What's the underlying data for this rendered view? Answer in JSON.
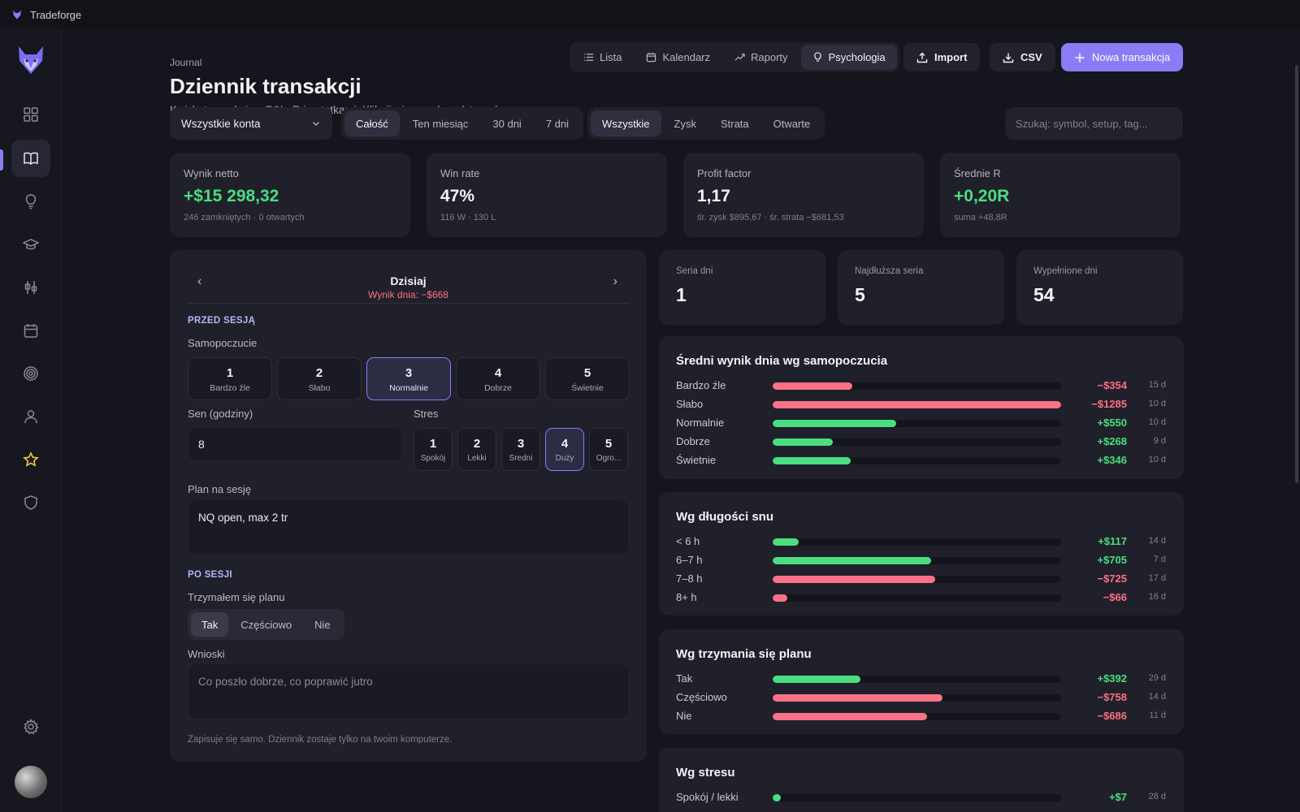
{
  "app": {
    "title": "Tradeforge"
  },
  "sidebar": {
    "items": [
      {
        "name": "dashboard",
        "icon": "grid-icon"
      },
      {
        "name": "journal",
        "icon": "book-icon",
        "active": true
      },
      {
        "name": "ideas",
        "icon": "lightbulb-icon"
      },
      {
        "name": "learn",
        "icon": "graduation-cap-icon"
      },
      {
        "name": "strategy",
        "icon": "sliders-icon"
      },
      {
        "name": "calendar",
        "icon": "calendar-icon"
      },
      {
        "name": "goals",
        "icon": "target-icon"
      },
      {
        "name": "profile",
        "icon": "user-icon"
      },
      {
        "name": "favorites",
        "icon": "star-icon"
      },
      {
        "name": "security",
        "icon": "shield-icon"
      }
    ],
    "accent": "#8b7cf6"
  },
  "header": {
    "breadcrumb": "Journal",
    "title": "Dziennik transakcji",
    "subtitle": "Każda transakcja z P&L, R i notatkami. Kliknij wiersz, aby edytować.",
    "view_tabs": [
      {
        "label": "Lista",
        "icon": "list-icon"
      },
      {
        "label": "Kalendarz",
        "icon": "calendar-icon"
      },
      {
        "label": "Raporty",
        "icon": "trend-icon"
      },
      {
        "label": "Psychologia",
        "icon": "lightbulb-icon",
        "active": true
      }
    ],
    "import_label": "Import",
    "csv_label": "CSV",
    "new_label": "Nowa transakcja"
  },
  "filters": {
    "account": "Wszystkie konta",
    "periods": [
      "Całość",
      "Ten miesiąc",
      "30 dni",
      "7 dni"
    ],
    "period_active": 0,
    "outcomes": [
      "Wszystkie",
      "Zysk",
      "Strata",
      "Otwarte"
    ],
    "outcome_active": 0,
    "search_placeholder": "Szukaj: symbol, setup, tag..."
  },
  "stats": [
    {
      "label": "Wynik netto",
      "value": "+$15 298,32",
      "sub": "246 zamkniętych · 0 otwartych",
      "tone": "green"
    },
    {
      "label": "Win rate",
      "value": "47%",
      "sub": "116 W · 130 L",
      "tone": "white"
    },
    {
      "label": "Profit factor",
      "value": "1,17",
      "sub": "śr. zysk $895,67 · śr. strata −$681,53",
      "tone": "white"
    },
    {
      "label": "Średnie R",
      "value": "+0,20R",
      "sub": "suma +48,8R",
      "tone": "green"
    }
  ],
  "journal": {
    "day": "Dzisiaj",
    "day_result": "Wynik dnia: −$668",
    "prev": "‹",
    "next": "›",
    "before_header": "PRZED SESJĄ",
    "mood_label": "Samopoczucie",
    "moods": [
      {
        "n": "1",
        "t": "Bardzo źle"
      },
      {
        "n": "2",
        "t": "Słabo"
      },
      {
        "n": "3",
        "t": "Normalnie"
      },
      {
        "n": "4",
        "t": "Dobrze"
      },
      {
        "n": "5",
        "t": "Świetnie"
      }
    ],
    "mood_selected": "3",
    "sleep_label": "Sen (godziny)",
    "sleep_value": "8",
    "stress_label": "Stres",
    "stress": [
      {
        "n": "1",
        "t": "Spokój"
      },
      {
        "n": "2",
        "t": "Lekki"
      },
      {
        "n": "3",
        "t": "Średni"
      },
      {
        "n": "4",
        "t": "Duży"
      },
      {
        "n": "5",
        "t": "Ogro..."
      }
    ],
    "stress_selected": "4",
    "plan_label": "Plan na sesję",
    "plan_value": "NQ open, max 2 tr",
    "after_header": "PO SESJI",
    "kept_plan_label": "Trzymałem się planu",
    "kept_plan_options": [
      "Tak",
      "Częściowo",
      "Nie"
    ],
    "kept_plan_selected": "Tak",
    "conclusions_label": "Wnioski",
    "conclusions_placeholder": "Co poszło dobrze, co poprawić jutro",
    "footnote": "Zapisuje się samo. Dziennik zostaje tylko na twoim komputerze."
  },
  "streaks": [
    {
      "label": "Seria dni",
      "value": "1"
    },
    {
      "label": "Najdłuższa seria",
      "value": "5"
    },
    {
      "label": "Wypełnione dni",
      "value": "54"
    }
  ],
  "breakdowns": [
    {
      "title": "Średni wynik dnia wg samopoczucia",
      "rows": [
        {
          "label": "Bardzo źle",
          "amount": "−$354",
          "value": -354,
          "days": "15 d"
        },
        {
          "label": "Słabo",
          "amount": "−$1285",
          "value": -1285,
          "days": "10 d"
        },
        {
          "label": "Normalnie",
          "amount": "+$550",
          "value": 550,
          "days": "10 d"
        },
        {
          "label": "Dobrze",
          "amount": "+$268",
          "value": 268,
          "days": "9 d"
        },
        {
          "label": "Świetnie",
          "amount": "+$346",
          "value": 346,
          "days": "10 d"
        }
      ]
    },
    {
      "title": "Wg długości snu",
      "rows": [
        {
          "label": "< 6 h",
          "amount": "+$117",
          "value": 117,
          "days": "14 d"
        },
        {
          "label": "6–7 h",
          "amount": "+$705",
          "value": 705,
          "days": "7 d"
        },
        {
          "label": "7–8 h",
          "amount": "−$725",
          "value": -725,
          "days": "17 d"
        },
        {
          "label": "8+ h",
          "amount": "−$66",
          "value": -66,
          "days": "16 d"
        }
      ]
    },
    {
      "title": "Wg trzymania się planu",
      "rows": [
        {
          "label": "Tak",
          "amount": "+$392",
          "value": 392,
          "days": "29 d"
        },
        {
          "label": "Częściowo",
          "amount": "−$758",
          "value": -758,
          "days": "14 d"
        },
        {
          "label": "Nie",
          "amount": "−$686",
          "value": -686,
          "days": "11 d"
        }
      ]
    },
    {
      "title": "Wg stresu",
      "rows": [
        {
          "label": "Spokój / lekki",
          "amount": "+$7",
          "value": 7,
          "days": "28 d"
        }
      ]
    }
  ],
  "colors": {
    "positive": "#4ade80",
    "negative": "#fb7185"
  }
}
